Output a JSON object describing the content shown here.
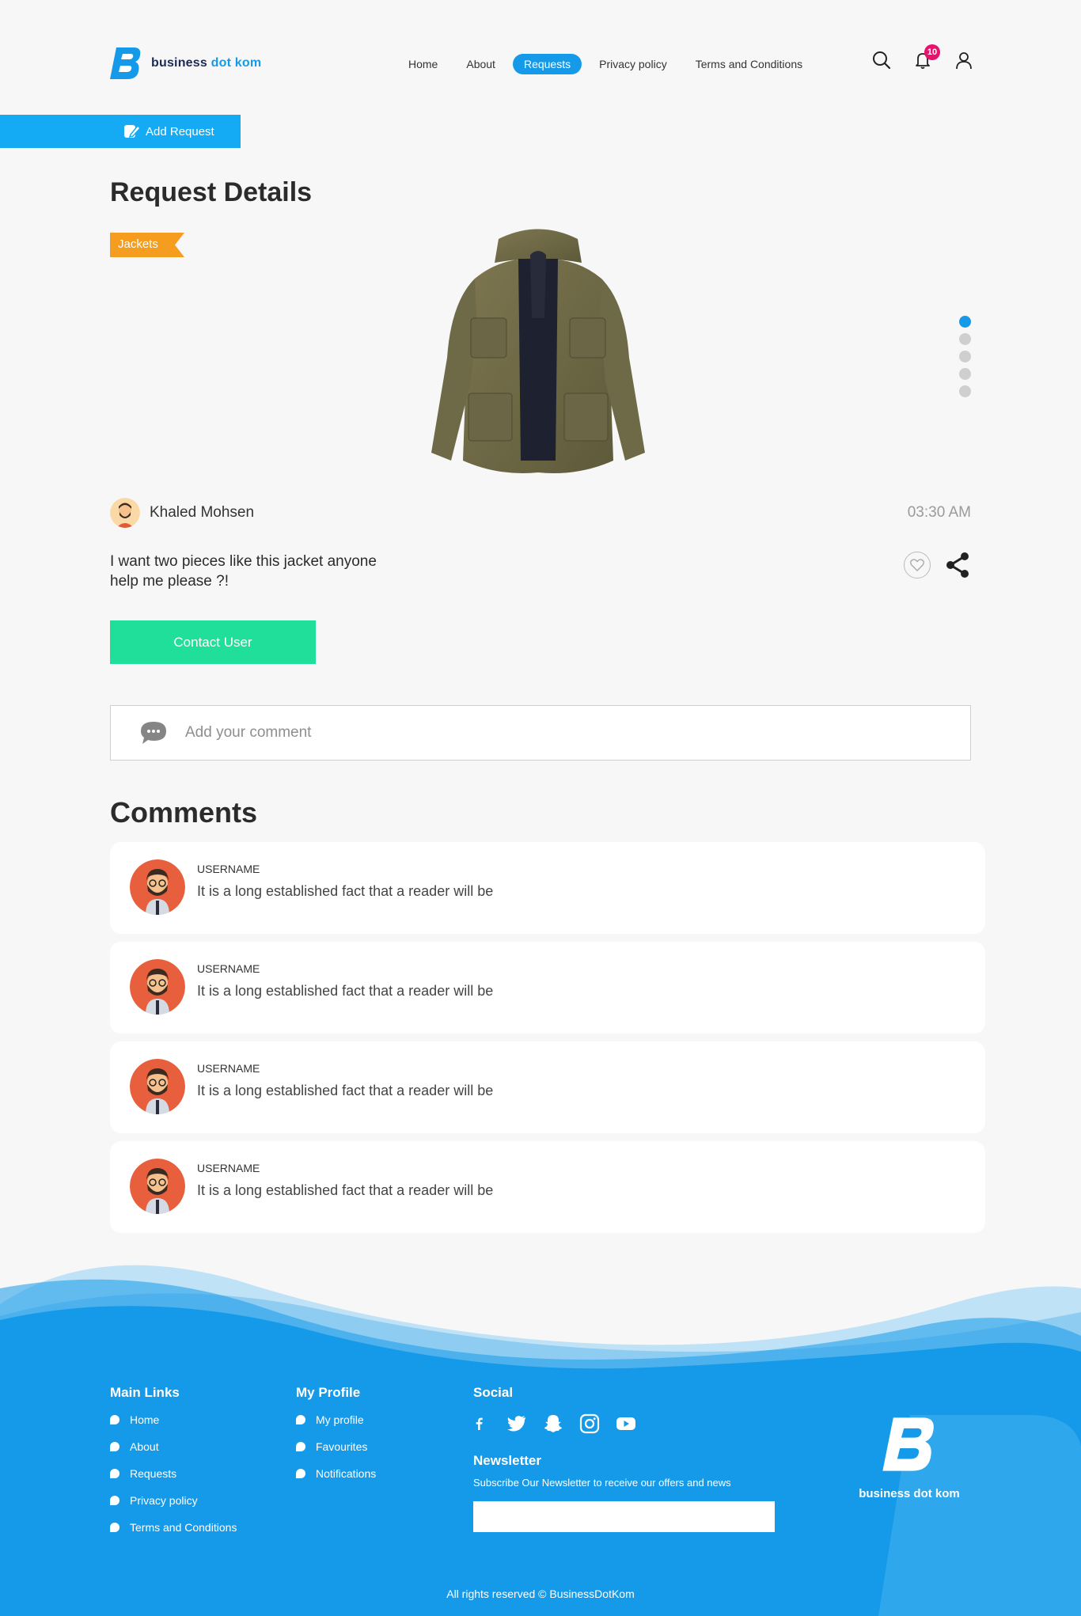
{
  "brand": {
    "name_part1": "business",
    "name_part2": "dot",
    "name_part3": "kom",
    "accent_color": "#159ae9",
    "footer_name": "business dot kom"
  },
  "nav": {
    "items": [
      {
        "label": "Home",
        "active": false
      },
      {
        "label": "About",
        "active": false
      },
      {
        "label": "Requests",
        "active": true
      },
      {
        "label": "Privacy policy",
        "active": false
      },
      {
        "label": "Terms and Conditions",
        "active": false
      }
    ],
    "notification_count": "10",
    "icons": [
      "search-icon",
      "bell-icon",
      "user-icon"
    ]
  },
  "add_request": {
    "label": "Add Request",
    "icon": "edit-icon"
  },
  "request": {
    "title": "Request Details",
    "category": "Jackets",
    "category_color": "#f59d1e",
    "image_alt": "jacket",
    "slides_total": 5,
    "slide_active": 1,
    "author": "Khaled Mohsen",
    "time": "03:30 AM",
    "description": "I want two pieces like this jacket anyone help me please ?!",
    "contact_label": "Contact User",
    "contact_color": "#1fdf9b"
  },
  "comment_input": {
    "placeholder": "Add your comment"
  },
  "comments": {
    "title": "Comments",
    "items": [
      {
        "username": "USERNAME",
        "text": "It is a long established fact that a reader will be"
      },
      {
        "username": "USERNAME",
        "text": "It is a long established fact that a reader will be"
      },
      {
        "username": "USERNAME",
        "text": "It is a long established fact that a reader will be"
      },
      {
        "username": "USERNAME",
        "text": "It is a long established fact that a reader will be"
      }
    ]
  },
  "footer": {
    "main_links": {
      "title": "Main Links",
      "items": [
        "Home",
        "About",
        "Requests",
        "Privacy policy",
        "Terms and Conditions"
      ]
    },
    "my_profile": {
      "title": "My Profile",
      "items": [
        "My profile",
        "Favourites",
        "Notifications"
      ]
    },
    "social": {
      "title": "Social",
      "icons": [
        "facebook-icon",
        "twitter-icon",
        "snapchat-icon",
        "instagram-icon",
        "youtube-icon"
      ]
    },
    "newsletter": {
      "title": "Newsletter",
      "subtitle": "Subscribe Our Newsletter to receive our offers and news",
      "placeholder": ""
    },
    "copyright": "All rights reserved © BusinessDotKom",
    "background_color": "#159ae9"
  }
}
